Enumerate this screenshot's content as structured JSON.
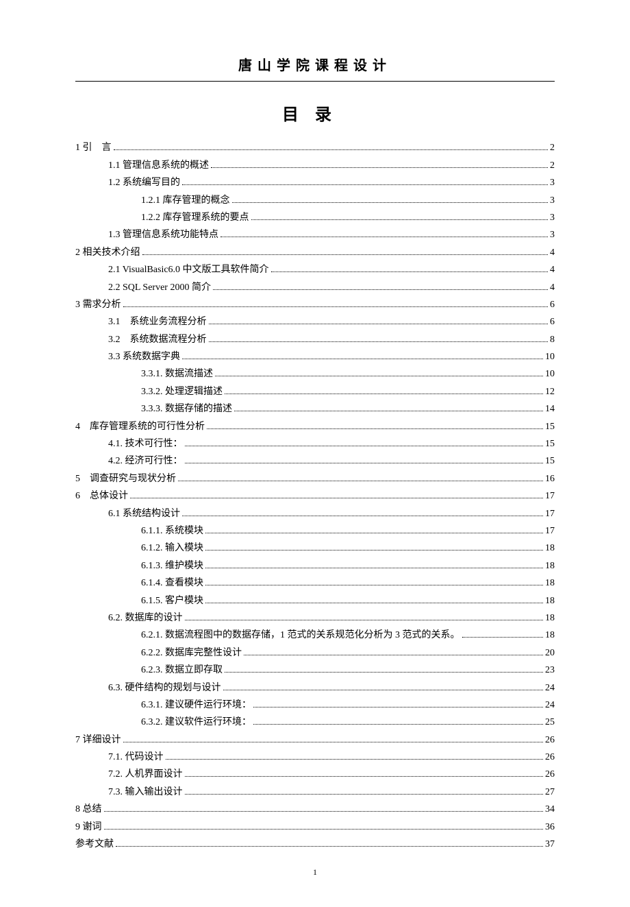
{
  "header": "唐山学院课程设计",
  "title": "目录",
  "page_number": "1",
  "toc": [
    {
      "level": 0,
      "label": "1 引　言",
      "page": "2"
    },
    {
      "level": 1,
      "label": "1.1 管理信息系统的概述",
      "page": "2"
    },
    {
      "level": 1,
      "label": "1.2 系统编写目的",
      "page": "3"
    },
    {
      "level": 2,
      "label": "1.2.1 库存管理的概念",
      "page": "3"
    },
    {
      "level": 2,
      "label": "1.2.2 库存管理系统的要点",
      "page": "3"
    },
    {
      "level": 1,
      "label": "1.3 管理信息系统功能特点",
      "page": "3"
    },
    {
      "level": 0,
      "label": "2 相关技术介绍",
      "page": "4"
    },
    {
      "level": 1,
      "label": "2.1 VisualBasic6.0 中文版工具软件简介",
      "page": "4"
    },
    {
      "level": 1,
      "label": "2.2 SQL Server 2000 简介",
      "page": "4"
    },
    {
      "level": 0,
      "label": "3 需求分析",
      "page": "6"
    },
    {
      "level": 1,
      "label": "3.1　系统业务流程分析",
      "page": "6"
    },
    {
      "level": 1,
      "label": "3.2　系统数据流程分析",
      "page": "8"
    },
    {
      "level": 1,
      "label": "3.3 系统数据字典",
      "page": "10"
    },
    {
      "level": 2,
      "label": "3.3.1. 数据流描述",
      "page": "10"
    },
    {
      "level": 2,
      "label": "3.3.2. 处理逻辑描述",
      "page": "12"
    },
    {
      "level": 2,
      "label": "3.3.3. 数据存储的描述",
      "page": "14"
    },
    {
      "level": 0,
      "label": "4　库存管理系统的可行性分析",
      "page": "15"
    },
    {
      "level": 1,
      "label": "4.1. 技术可行性：",
      "page": "15"
    },
    {
      "level": 1,
      "label": "4.2. 经济可行性：",
      "page": "15"
    },
    {
      "level": 0,
      "label": "5　调查研究与现状分析",
      "page": "16"
    },
    {
      "level": 0,
      "label": "6　总体设计",
      "page": "17"
    },
    {
      "level": 1,
      "label": "6.1 系统结构设计",
      "page": "17"
    },
    {
      "level": 2,
      "label": "6.1.1. 系统模块",
      "page": "17"
    },
    {
      "level": 2,
      "label": "6.1.2. 输入模块",
      "page": "18"
    },
    {
      "level": 2,
      "label": "6.1.3. 维护模块",
      "page": "18"
    },
    {
      "level": 2,
      "label": "6.1.4. 查看模块",
      "page": "18"
    },
    {
      "level": 2,
      "label": "6.1.5. 客户模块",
      "page": "18"
    },
    {
      "level": 1,
      "label": "6.2. 数据库的设计",
      "page": "18"
    },
    {
      "level": 2,
      "label": "6.2.1. 数据流程图中的数据存储，1 范式的关系规范化分析为 3 范式的关系。",
      "page": "18"
    },
    {
      "level": 2,
      "label": "6.2.2. 数据库完整性设计",
      "page": "20"
    },
    {
      "level": 2,
      "label": "6.2.3. 数据立即存取",
      "page": "23"
    },
    {
      "level": 1,
      "label": "6.3. 硬件结构的规划与设计",
      "page": "24"
    },
    {
      "level": 2,
      "label": "6.3.1. 建议硬件运行环境：",
      "page": "24"
    },
    {
      "level": 2,
      "label": "6.3.2. 建议软件运行环境：",
      "page": "25"
    },
    {
      "level": 0,
      "label": "7 详细设计",
      "page": "26"
    },
    {
      "level": 1,
      "label": "7.1. 代码设计",
      "page": "26"
    },
    {
      "level": 1,
      "label": "7.2. 人机界面设计",
      "page": "26"
    },
    {
      "level": 1,
      "label": "7.3. 输入输出设计",
      "page": "27"
    },
    {
      "level": 0,
      "label": "8 总结",
      "page": "34"
    },
    {
      "level": 0,
      "label": "9 谢词",
      "page": "36"
    },
    {
      "level": 0,
      "label": "参考文献",
      "page": "37"
    }
  ]
}
